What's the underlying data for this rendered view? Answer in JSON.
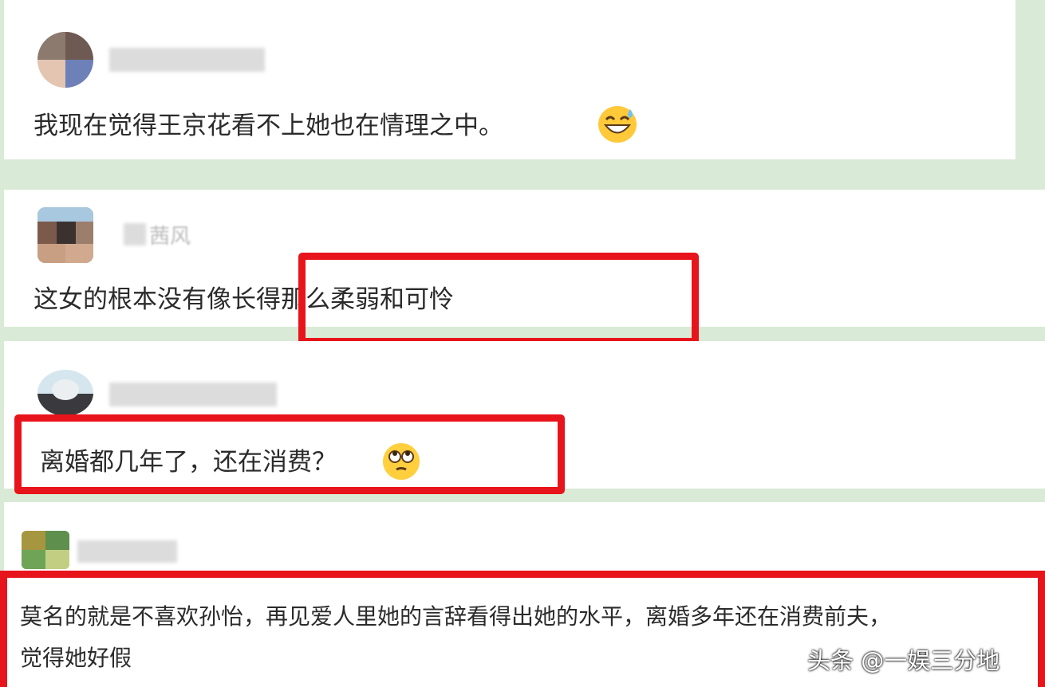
{
  "comments": [
    {
      "username": "",
      "text": "我现在觉得王京花看不上她也在情理之中。",
      "emoji": "grinning-sweat-emoji"
    },
    {
      "username": "茜风",
      "text": "这女的根本没有像长得那么柔弱和可怜"
    },
    {
      "username": "",
      "text": "离婚都几年了，还在消费？",
      "emoji": "eye-roll-emoji"
    },
    {
      "username": "",
      "text_line1": "莫名的就是不喜欢孙怡，再见爱人里她的言辞看得出她的水平，离婚多年还在消费前夫，",
      "text_line2": "觉得她好假"
    }
  ],
  "watermark": "头条 @一娱三分地",
  "colors": {
    "highlight": "#e8141b",
    "background": "#d9ead6",
    "card": "#ffffff"
  }
}
